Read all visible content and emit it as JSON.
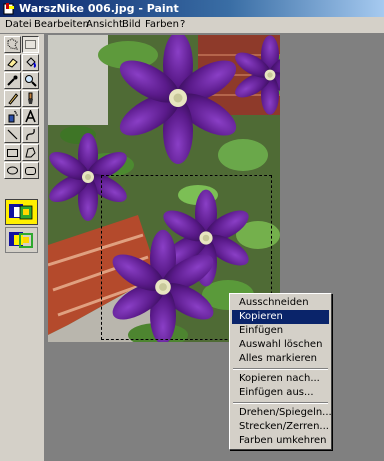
{
  "window": {
    "title": "WarszNike 006.jpg - Paint",
    "icon": "paint-app-icon"
  },
  "menubar": {
    "items": [
      "Datei",
      "Bearbeiten",
      "Ansicht",
      "Bild",
      "Farben",
      "?"
    ]
  },
  "toolbox": {
    "tools": [
      "free-select-icon",
      "rect-select-icon",
      "eraser-icon",
      "fill-icon",
      "pick-color-icon",
      "magnifier-icon",
      "pencil-icon",
      "brush-icon",
      "airbrush-icon",
      "text-icon",
      "line-icon",
      "curve-icon",
      "rectangle-icon",
      "polygon-icon",
      "ellipse-icon",
      "rounded-rect-icon"
    ],
    "selected": "rect-select-icon"
  },
  "context_menu": {
    "items": [
      "Ausschneiden",
      "Kopieren",
      "Einfügen",
      "Auswahl löschen",
      "Alles markieren",
      "Kopieren nach...",
      "Einfügen aus...",
      "Drehen/Spiegeln...",
      "Strecken/Zerren...",
      "Farben umkehren"
    ],
    "highlighted": "Kopieren"
  },
  "colors": {
    "title_start": "#0a246a",
    "title_end": "#a6caf0",
    "face": "#d4d0c8",
    "highlight": "#0a246a",
    "workspace": "#808080"
  }
}
